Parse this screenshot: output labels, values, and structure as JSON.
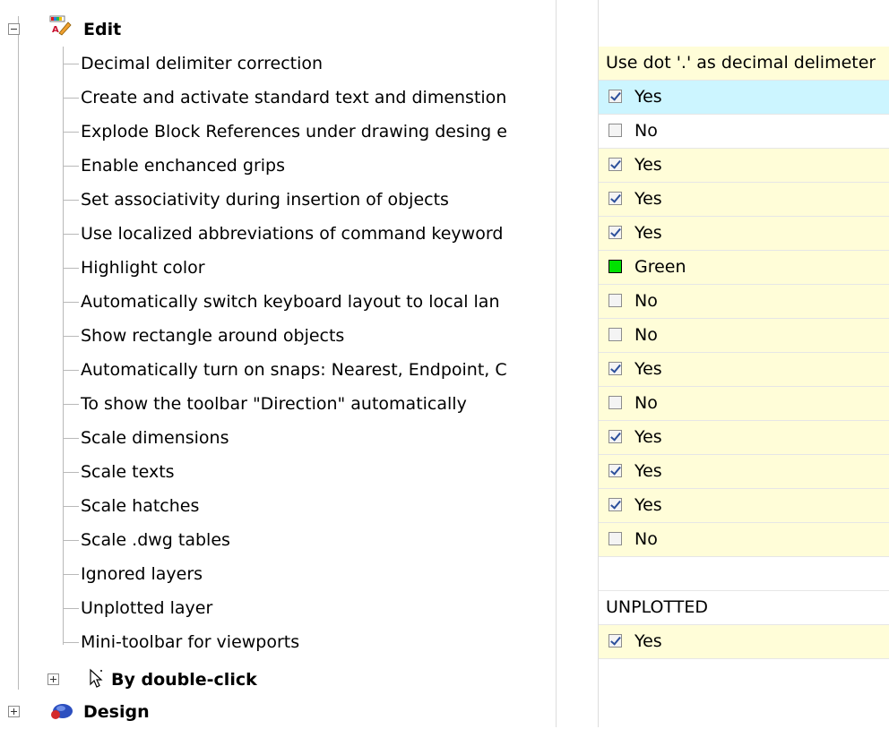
{
  "groups": {
    "edit": {
      "label": "Edit",
      "expander": "minus"
    },
    "by_double_click": {
      "label": "By double-click",
      "expander": "plus"
    },
    "design": {
      "label": "Design",
      "expander": "plus"
    }
  },
  "properties": [
    {
      "label": "Decimal delimiter correction",
      "value": "Use dot '.' as decimal delimeter",
      "kind": "text",
      "bg": "#fffdd8"
    },
    {
      "label": "Create and activate standard text and dimenstion",
      "value": "Yes",
      "kind": "check",
      "checked": true,
      "bg": "#ccf5ff"
    },
    {
      "label": "Explode Block References under drawing desing e",
      "value": "No",
      "kind": "check",
      "checked": false,
      "bg": "#ffffff"
    },
    {
      "label": "Enable enchanced grips",
      "value": "Yes",
      "kind": "check",
      "checked": true,
      "bg": "#fffdd8"
    },
    {
      "label": "Set associativity during insertion of objects",
      "value": "Yes",
      "kind": "check",
      "checked": true,
      "bg": "#fffdd8"
    },
    {
      "label": "Use localized abbreviations of command keyword",
      "value": "Yes",
      "kind": "check",
      "checked": true,
      "bg": "#fffdd8"
    },
    {
      "label": "Highlight color",
      "value": "Green",
      "kind": "color",
      "swatch": "#00e100",
      "bg": "#fffdd8"
    },
    {
      "label": "Automatically switch keyboard layout to local lan",
      "value": "No",
      "kind": "check",
      "checked": false,
      "bg": "#fffdd8"
    },
    {
      "label": "Show rectangle around objects",
      "value": "No",
      "kind": "check",
      "checked": false,
      "bg": "#fffdd8"
    },
    {
      "label": "Automatically turn on snaps: Nearest, Endpoint, C",
      "value": "Yes",
      "kind": "check",
      "checked": true,
      "bg": "#fffdd8"
    },
    {
      "label": "To show the toolbar \"Direction\" automatically",
      "value": "No",
      "kind": "check",
      "checked": false,
      "bg": "#fffdd8"
    },
    {
      "label": "Scale dimensions",
      "value": "Yes",
      "kind": "check",
      "checked": true,
      "bg": "#fffdd8"
    },
    {
      "label": "Scale texts",
      "value": "Yes",
      "kind": "check",
      "checked": true,
      "bg": "#fffdd8"
    },
    {
      "label": "Scale hatches",
      "value": "Yes",
      "kind": "check",
      "checked": true,
      "bg": "#fffdd8"
    },
    {
      "label": "Scale .dwg tables",
      "value": "No",
      "kind": "check",
      "checked": false,
      "bg": "#fffdd8"
    },
    {
      "label": "Ignored layers",
      "value": "",
      "kind": "text",
      "bg": "#ffffff"
    },
    {
      "label": "Unplotted layer",
      "value": "UNPLOTTED",
      "kind": "text",
      "bg": "#ffffff"
    },
    {
      "label": "Mini-toolbar for viewports",
      "value": "Yes",
      "kind": "check",
      "checked": true,
      "bg": "#fffdd8"
    }
  ]
}
